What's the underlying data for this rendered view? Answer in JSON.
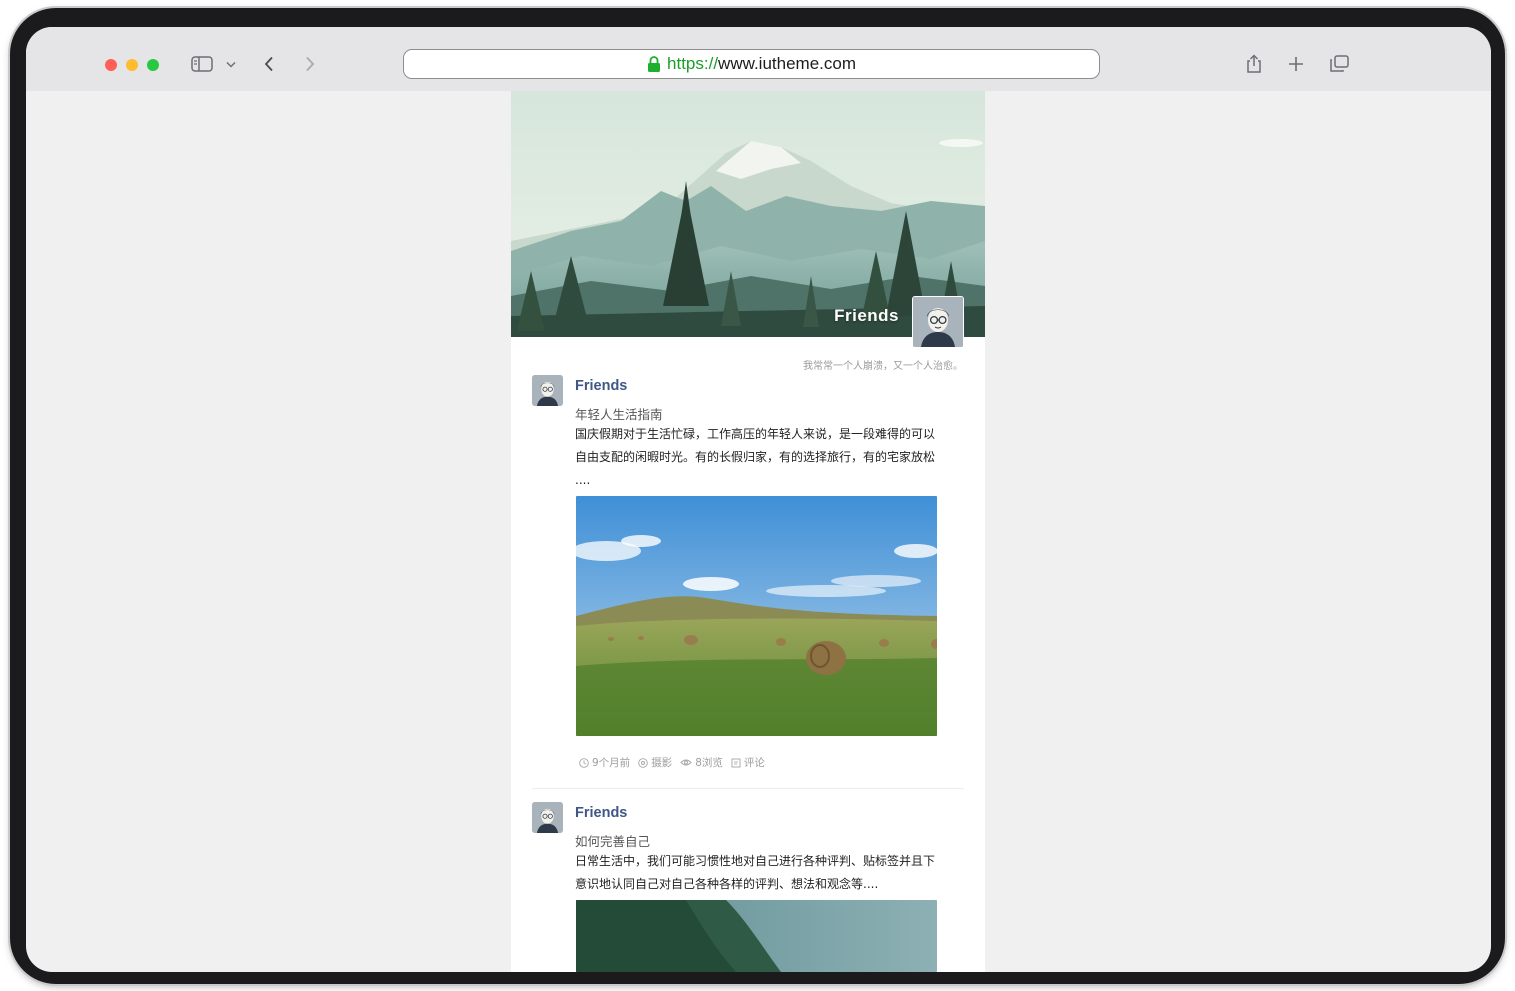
{
  "browser": {
    "url_scheme": "https://",
    "url_host": "www.iutheme.com",
    "icons": [
      "sidebar-icon",
      "chevron-down-icon",
      "back-icon",
      "forward-icon",
      "lock-icon",
      "share-icon",
      "plus-icon",
      "tabs-icon"
    ]
  },
  "profile": {
    "name": "Friends",
    "motto": "我常常一个人崩溃，又一个人治愈。"
  },
  "posts": [
    {
      "author": "Friends",
      "title": "年轻人生活指南",
      "excerpt": "国庆假期对于生活忙碌，工作高压的年轻人来说，是一段难得的可以自由支配的闲暇时光。有的长假归家，有的选择旅行，有的宅家放松 ....",
      "meta": {
        "time": "9个月前",
        "category": "摄影",
        "views": "8浏览",
        "comments": "评论"
      }
    },
    {
      "author": "Friends",
      "title": "如何完善自己",
      "excerpt": "日常生活中，我们可能习惯性地对自己进行各种评判、贴标签并且下意识地认同自己对自己各种各样的评判、想法和观念等...."
    }
  ],
  "colors": {
    "author": "#3f5786",
    "secure": "#1a9e28",
    "page_bg": "#f0f0f0"
  }
}
